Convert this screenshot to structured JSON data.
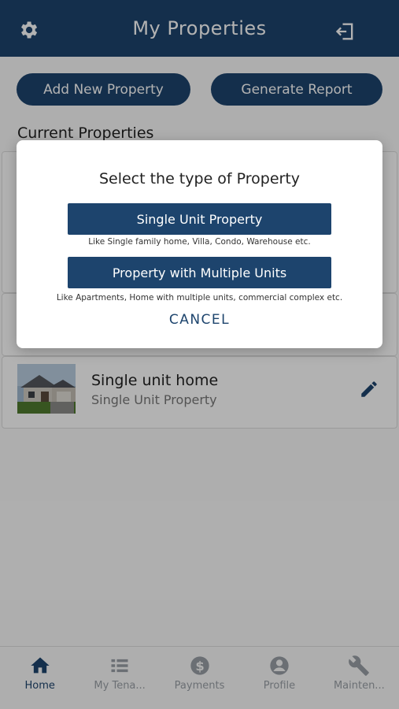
{
  "header": {
    "title": "My Properties",
    "settings_icon": "gear-icon",
    "logout_icon": "logout-icon"
  },
  "actions": {
    "add_label": "Add New Property",
    "report_label": "Generate Report"
  },
  "section": {
    "title": "Current Properties"
  },
  "properties": [
    {
      "name": "Single unit home",
      "type": "Single Unit Property"
    }
  ],
  "dialog": {
    "title": "Select the type of Property",
    "option1_label": "Single Unit Property",
    "option1_note": "Like Single family home, Villa, Condo, Warehouse etc.",
    "option2_label": "Property with Multiple Units",
    "option2_note": "Like Apartments, Home with multiple units, commercial complex etc.",
    "cancel_label": "CANCEL"
  },
  "tabs": [
    {
      "label": "Home",
      "icon": "home-icon",
      "active": true
    },
    {
      "label": "My Tena...",
      "icon": "list-icon",
      "active": false
    },
    {
      "label": "Payments",
      "icon": "dollar-icon",
      "active": false
    },
    {
      "label": "Profile",
      "icon": "person-icon",
      "active": false
    },
    {
      "label": "Mainten...",
      "icon": "wrench-icon",
      "active": false
    }
  ],
  "colors": {
    "primary": "#1d446d",
    "inactive_tab": "#9aa0a6",
    "overlay": "rgba(0,0,0,0.30)"
  }
}
